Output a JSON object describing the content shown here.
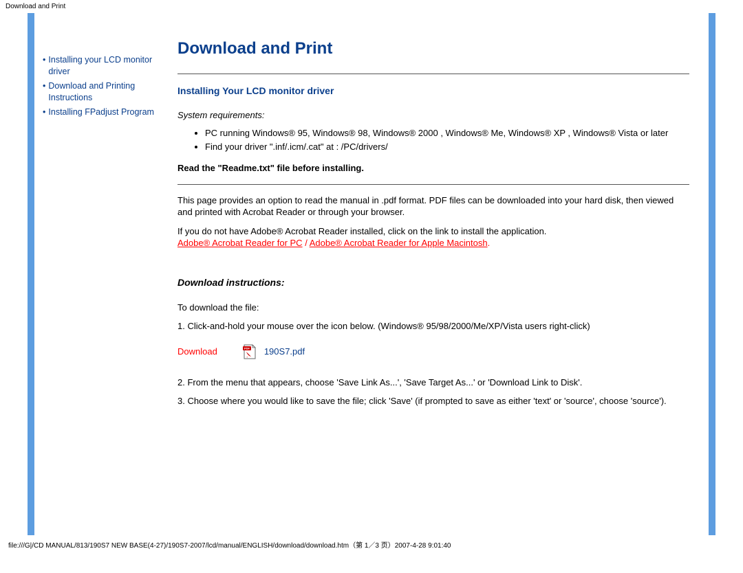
{
  "top_label": "Download and Print",
  "sidebar": {
    "items": [
      {
        "label": "Installing your LCD monitor driver"
      },
      {
        "label": "Download and Printing Instructions"
      },
      {
        "label": "Installing FPadjust Program"
      }
    ]
  },
  "main": {
    "title": "Download and Print",
    "section1_heading": "Installing Your LCD monitor driver",
    "sysreq_label": "System requirements:",
    "sysreq_items": [
      "PC running Windows® 95, Windows® 98, Windows® 2000 , Windows® Me, Windows® XP , Windows® Vista or later",
      "Find your driver \".inf/.icm/.cat\" at : /PC/drivers/"
    ],
    "readme_warning": "Read the \"Readme.txt\" file before installing.",
    "para1": "This page provides an option to read the manual in .pdf format. PDF files can be downloaded into your hard disk, then viewed and printed with Acrobat Reader or through your browser.",
    "para2_pre": "If you do not have Adobe® Acrobat Reader installed, click on the link to install the application.",
    "acrobat_pc": "Adobe® Acrobat Reader for PC",
    "acrobat_sep": " / ",
    "acrobat_mac": "Adobe® Acrobat Reader for Apple Macintosh",
    "acrobat_end": ".",
    "download_heading": "Download instructions:",
    "to_download": "To download the file:",
    "step1": "1. Click-and-hold your mouse over the icon below. (Windows® 95/98/2000/Me/XP/Vista users right-click)",
    "download_label": "Download",
    "pdf_name": "190S7.pdf",
    "step2": "2. From the menu that appears, choose 'Save Link As...', 'Save Target As...' or 'Download Link to Disk'.",
    "step3": "3. Choose where you would like to save the file; click 'Save' (if prompted to save as either 'text' or 'source', choose 'source')."
  },
  "footer": "file:///G|/CD MANUAL/813/190S7 NEW BASE(4-27)/190S7-2007/lcd/manual/ENGLISH/download/download.htm（第 1／3 页）2007-4-28 9:01:40"
}
